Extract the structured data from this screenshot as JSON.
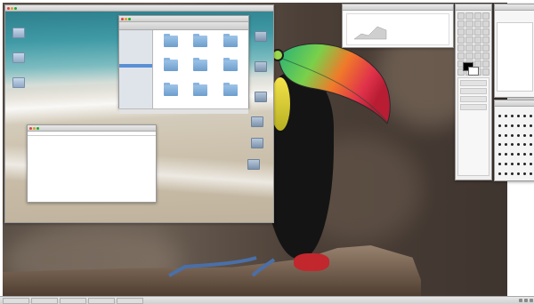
{
  "screen_window": {
    "title": "",
    "inner_desktop_icons": [
      "",
      "",
      ""
    ]
  },
  "finder": {
    "title": "",
    "sidebar": [
      "",
      "",
      "",
      "",
      "",
      "",
      "",
      "",
      "",
      "",
      "",
      "",
      "",
      "",
      "",
      "",
      ""
    ],
    "selected_index": 9,
    "folders": [
      "",
      "",
      "",
      "",
      "",
      "",
      "",
      "",
      ""
    ]
  },
  "table_window": {
    "title": "",
    "headers": [
      "",
      "",
      "",
      "",
      "",
      "",
      ""
    ],
    "rows": [
      [
        "",
        "",
        "",
        "",
        "",
        "",
        ""
      ],
      [
        "",
        "",
        "",
        "",
        "",
        "",
        ""
      ],
      [
        "",
        "",
        "",
        "",
        "",
        "",
        ""
      ],
      [
        "",
        "",
        "",
        "",
        "",
        "",
        ""
      ],
      [
        "",
        "",
        "",
        "",
        "",
        "",
        ""
      ],
      [
        "",
        "",
        "",
        "",
        "",
        "",
        ""
      ],
      [
        "",
        "",
        "",
        "",
        "",
        "",
        ""
      ],
      [
        "",
        "",
        "",
        "",
        "",
        "",
        ""
      ],
      [
        "",
        "",
        "",
        "",
        "",
        "",
        ""
      ],
      [
        "",
        "",
        "",
        "",
        "",
        "",
        ""
      ],
      [
        "",
        "",
        "",
        "",
        "",
        "",
        ""
      ],
      [
        "",
        "",
        "",
        "",
        "",
        "",
        ""
      ],
      [
        "",
        "",
        "",
        "",
        "",
        "",
        ""
      ],
      [
        "",
        "",
        "",
        "",
        "",
        "",
        ""
      ],
      [
        "",
        "",
        "",
        "",
        "",
        "",
        ""
      ],
      [
        "",
        "",
        "",
        "",
        "",
        "",
        ""
      ]
    ]
  },
  "preview_window": {
    "title": ""
  },
  "toolbox": {
    "title": ""
  },
  "layers": {
    "title": ""
  },
  "brushes": {
    "title": ""
  },
  "taskbar": {
    "buttons": [
      "",
      "",
      "",
      "",
      ""
    ]
  },
  "colors": {
    "toucan_beak_green": "#2fb86a",
    "toucan_beak_orange": "#ef6f2a",
    "toucan_beak_red": "#d3233b",
    "selection_blue": "#5a8fd6"
  }
}
